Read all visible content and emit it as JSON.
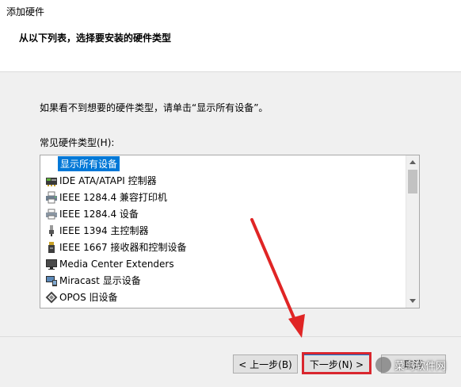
{
  "window": {
    "title": "添加硬件"
  },
  "header": {
    "heading": "从以下列表，选择要安装的硬件类型"
  },
  "content": {
    "hint": "如果看不到想要的硬件类型，请单击“显示所有设备”。",
    "list_label": "常见硬件类型(H):",
    "items": [
      {
        "label": "显示所有设备",
        "icon": "none",
        "selected": true
      },
      {
        "label": "IDE ATA/ATAPI 控制器",
        "icon": "ide-controller-icon"
      },
      {
        "label": "IEEE 1284.4 兼容打印机",
        "icon": "printer-icon"
      },
      {
        "label": "IEEE 1284.4 设备",
        "icon": "printer-device-icon"
      },
      {
        "label": "IEEE 1394 主控制器",
        "icon": "firewire-icon"
      },
      {
        "label": "IEEE 1667 接收器和控制设备",
        "icon": "storage-icon"
      },
      {
        "label": "Media Center Extenders",
        "icon": "monitor-icon"
      },
      {
        "label": "Miracast 显示设备",
        "icon": "miracast-icon"
      },
      {
        "label": "OPOS 旧设备",
        "icon": "opos-icon"
      }
    ]
  },
  "footer": {
    "back_label": "< 上一步(B)",
    "next_label": "下一步(N) >",
    "cancel_label": "取消"
  },
  "watermark": {
    "text": "菜鸟软件网"
  },
  "colors": {
    "selection": "#0078d7",
    "highlight": "#d9262e"
  }
}
